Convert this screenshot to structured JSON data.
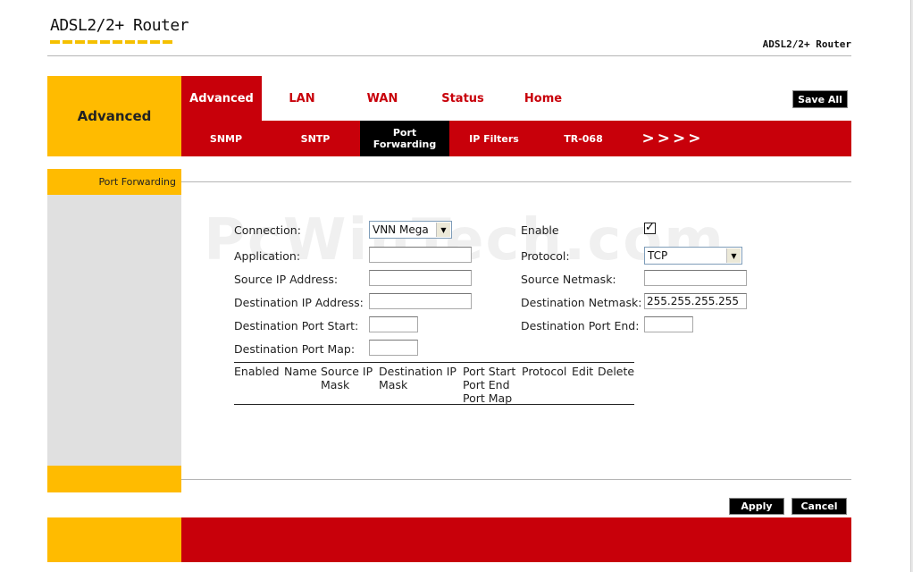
{
  "header": {
    "logo": "ADSL2/2+ Router",
    "brand": "ADSL2/2+ Router"
  },
  "nav": {
    "section": "Advanced",
    "tabs": [
      {
        "label": "Advanced"
      },
      {
        "label": "LAN"
      },
      {
        "label": "WAN"
      },
      {
        "label": "Status"
      },
      {
        "label": "Home"
      }
    ],
    "save_all": "Save All",
    "subtabs": [
      {
        "label": "SNMP"
      },
      {
        "label": "SNTP"
      },
      {
        "label": "Port Forwarding"
      },
      {
        "label": "IP Filters"
      },
      {
        "label": "TR-068"
      },
      {
        "label": ">>>>"
      }
    ]
  },
  "sidebar": {
    "title": "Port Forwarding"
  },
  "watermark": "PcWinTech.com",
  "form": {
    "connection": {
      "label": "Connection:",
      "value": "VNN Mega"
    },
    "enable": {
      "label": "Enable",
      "checked": true
    },
    "application": {
      "label": "Application:",
      "value": ""
    },
    "protocol": {
      "label": "Protocol:",
      "value": "TCP"
    },
    "source_ip": {
      "label": "Source IP Address:",
      "value": ""
    },
    "source_netmask": {
      "label": "Source Netmask:",
      "value": ""
    },
    "dest_ip": {
      "label": "Destination IP Address:",
      "value": ""
    },
    "dest_netmask": {
      "label": "Destination Netmask:",
      "value": "255.255.255.255"
    },
    "dest_port_start": {
      "label": "Destination Port Start:",
      "value": ""
    },
    "dest_port_end": {
      "label": "Destination Port End:",
      "value": ""
    },
    "dest_port_map": {
      "label": "Destination Port Map:",
      "value": ""
    }
  },
  "table": {
    "headers": {
      "enabled": "Enabled",
      "name": "Name",
      "source_ip_line1": "Source IP",
      "source_ip_line2": "Mask",
      "destination_ip_line1": "Destination IP",
      "destination_ip_line2": "Mask",
      "port_line1": "Port Start",
      "port_line2": "Port End",
      "port_line3": "Port Map",
      "protocol": "Protocol",
      "edit": "Edit",
      "delete": "Delete"
    },
    "rows": []
  },
  "actions": {
    "apply": "Apply",
    "cancel": "Cancel"
  }
}
